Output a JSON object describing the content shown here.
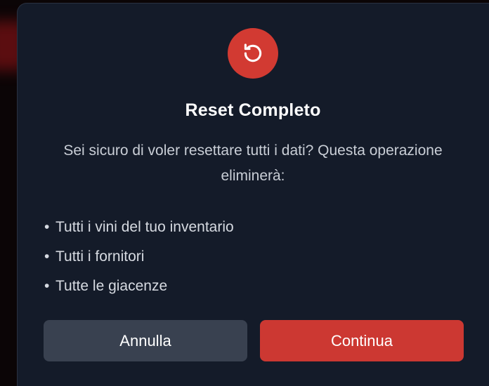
{
  "dialog": {
    "icon": "reset-arrow-icon",
    "title": "Reset Completo",
    "message": "Sei sicuro di voler resettare tutti i dati? Questa operazione eliminerà:",
    "items": [
      "Tutti i vini del tuo inventario",
      "Tutti i fornitori",
      "Tutte le giacenze"
    ],
    "bullet": "•",
    "cancel_label": "Annulla",
    "continue_label": "Continua"
  },
  "colors": {
    "modal_bg": "#141b29",
    "accent_red": "#cc3832",
    "cancel_bg": "#394150"
  }
}
